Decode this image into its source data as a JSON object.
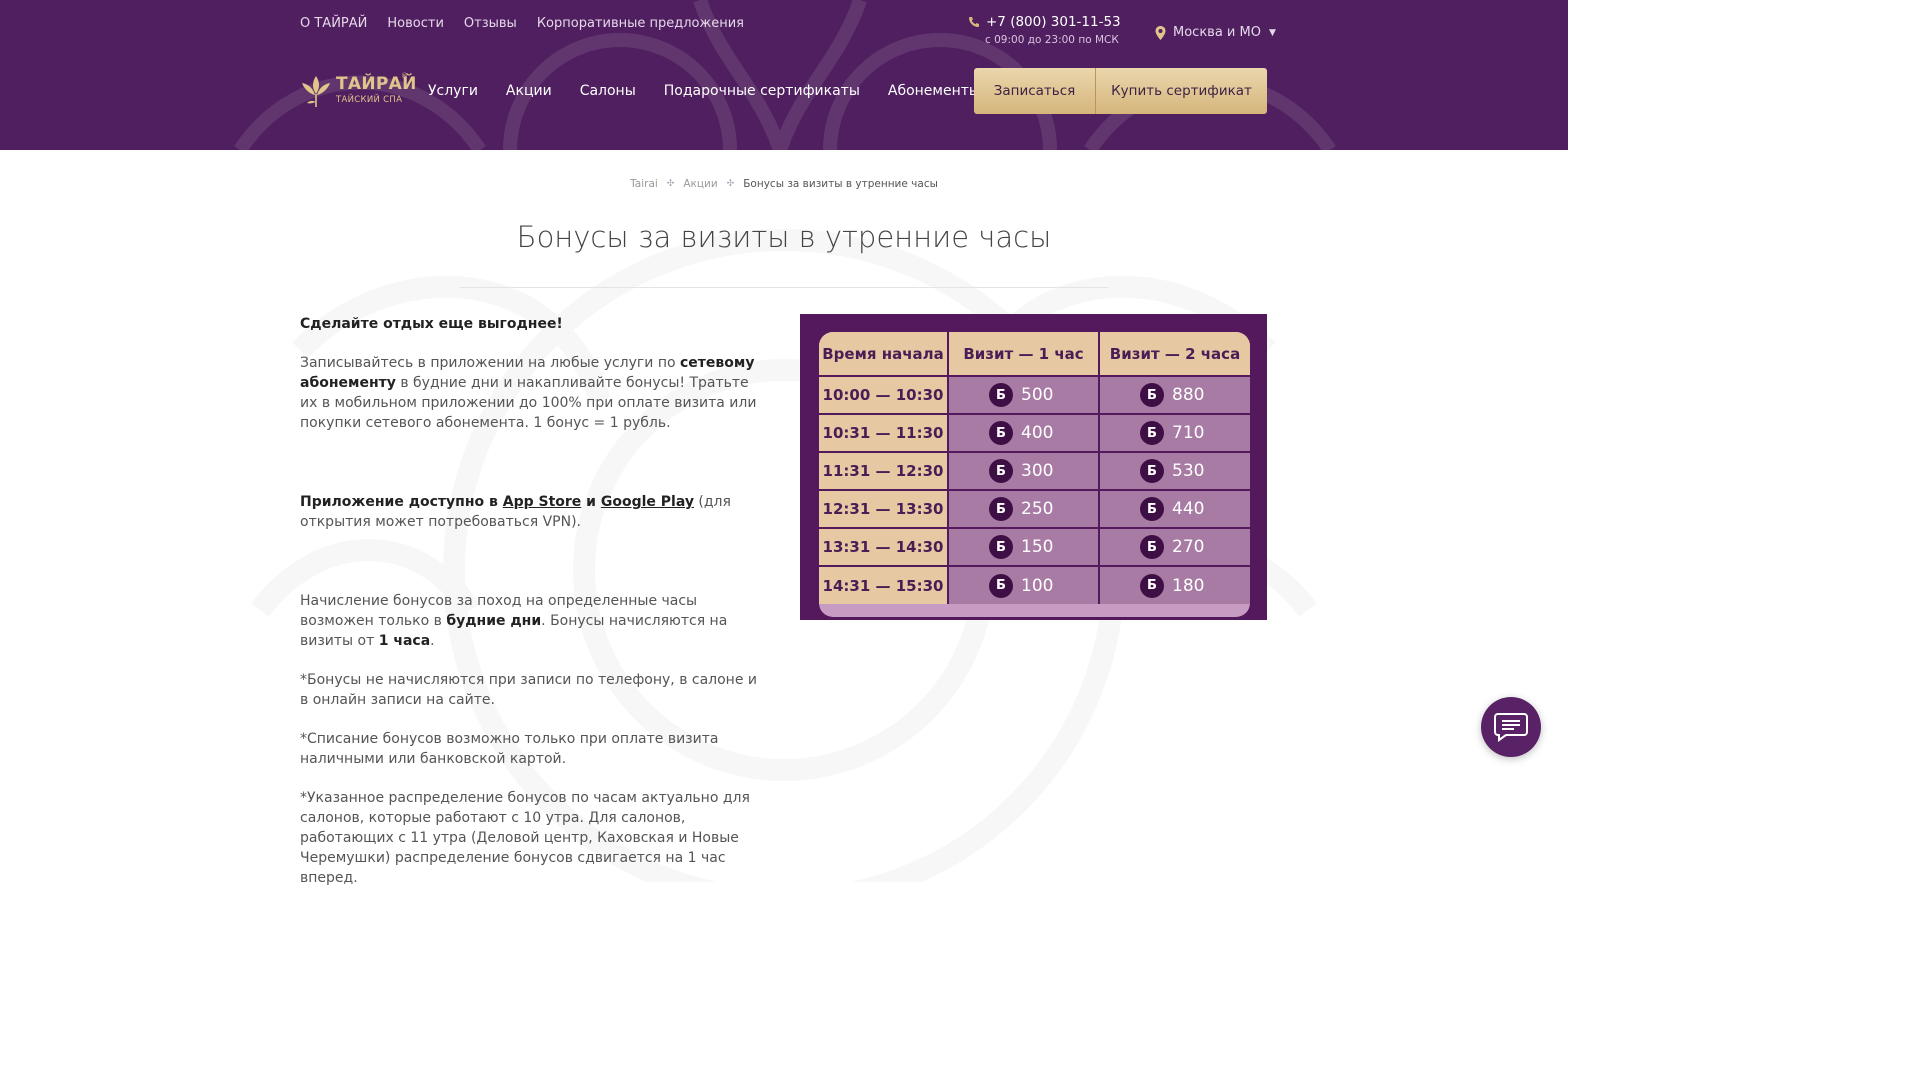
{
  "colors": {
    "header_bg": "#4f1f5f",
    "gold": "#e0c48a",
    "table_frame": "#54195c",
    "table_cell": "#a87ba4",
    "table_head": "#e6c9a3"
  },
  "top_nav": [
    "О ТАЙРАЙ",
    "Новости",
    "Отзывы",
    "Корпоративные предложения"
  ],
  "contact": {
    "phone": "+7 (800) 301-11-53",
    "hours": "с 09:00 до 23:00 по МСК",
    "phone_icon": "phone-icon"
  },
  "city": {
    "label": "Москва и МО",
    "icon": "location-pin-icon"
  },
  "logo": {
    "brand": "ТАЙРАЙ",
    "sub": "ТАЙСКИЙ СПА",
    "reg": "®"
  },
  "main_nav": [
    "Услуги",
    "Акции",
    "Салоны",
    "Подарочные сертификаты",
    "Абонементы"
  ],
  "buttons": {
    "book": "Записаться",
    "buy_cert": "Купить сертификат"
  },
  "breadcrumb": {
    "home": "Tairai",
    "section": "Акции",
    "current": "Бонусы за визиты в утренние часы"
  },
  "page_title": "Бонусы за визиты в утренние часы",
  "content": {
    "lead": "Сделайте отдых еще выгоднее!",
    "p1_a": "Записывайтесь в приложении на любые услуги по ",
    "p1_b": "сетевому абонементу",
    "p1_c": " в будние дни и накапливайте бонусы! Тратьте их в мобильном приложении до 100% при оплате визита или покупки сетевого абонемента. 1 бонус = 1 рубль.",
    "p2_a": "Приложение доступно в ",
    "p2_appstore": "App Store",
    "p2_and": " и ",
    "p2_googleplay": "Google Play",
    "p2_b": " (для открытия может потребоваться VPN).",
    "p3_a": "Начисление бонусов за поход на определенные часы возможен только в ",
    "p3_b": "будние дни",
    "p3_c": ". Бонусы начисляются на визиты от ",
    "p3_d": "1 часа",
    "p3_e": ".",
    "note1": "*Бонусы не начисляются при записи по телефону, в салоне и в онлайн записи на сайте.",
    "note2": "*Списание бонусов возможно только при оплате визита наличными или банковской картой.",
    "note3": "*Указанное распределение бонусов по часам актуально для салонов, которые работают с 10 утра. Для салонов, работающих с 11 утра (Деловой центр, Каховская и Новые Черемушки) распределение бонусов сдвигается на 1 час вперед."
  },
  "bonus_table": {
    "headers": [
      "Время начала",
      "Визит — 1 час",
      "Визит — 2 часа"
    ],
    "coin": "Б",
    "rows": [
      {
        "time": "10:00 — 10:30",
        "h1": "500",
        "h2": "880"
      },
      {
        "time": "10:31 — 11:30",
        "h1": "400",
        "h2": "710"
      },
      {
        "time": "11:31 — 12:30",
        "h1": "300",
        "h2": "530"
      },
      {
        "time": "12:31 — 13:30",
        "h1": "250",
        "h2": "440"
      },
      {
        "time": "13:31 — 14:30",
        "h1": "150",
        "h2": "270"
      },
      {
        "time": "14:31 — 15:30",
        "h1": "100",
        "h2": "180"
      }
    ]
  },
  "chat": {
    "icon": "chat-icon"
  }
}
